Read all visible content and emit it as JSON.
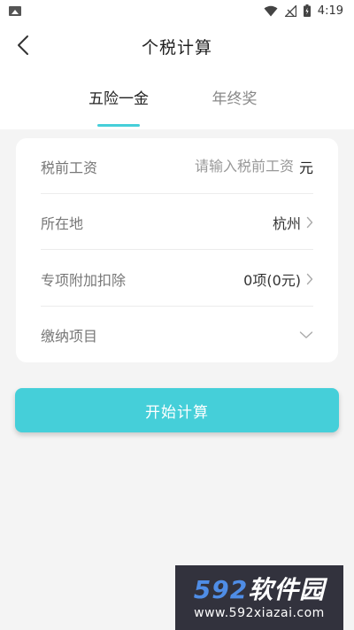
{
  "status_bar": {
    "time": "4:19",
    "icons": [
      "image-icon",
      "wifi-icon",
      "signal-icon",
      "battery-icon"
    ]
  },
  "header": {
    "title": "个税计算",
    "back_icon": "back-arrow-icon"
  },
  "tabs": [
    {
      "label": "五险一金",
      "active": true
    },
    {
      "label": "年终奖",
      "active": false
    }
  ],
  "form": {
    "salary": {
      "label": "税前工资",
      "placeholder": "请输入税前工资",
      "value": "",
      "unit": "元"
    },
    "location": {
      "label": "所在地",
      "value": "杭州"
    },
    "deduction": {
      "label": "专项附加扣除",
      "value": "0项(0元)"
    },
    "payment_items": {
      "label": "缴纳项目"
    }
  },
  "actions": {
    "start_label": "开始计算"
  },
  "watermark": {
    "logo_prefix": "592",
    "logo_text": "软件园",
    "url": "www.592xiazai.com"
  },
  "colors": {
    "accent": "#45cfd9",
    "page_bg": "#f4f4f4",
    "card_bg": "#ffffff"
  }
}
